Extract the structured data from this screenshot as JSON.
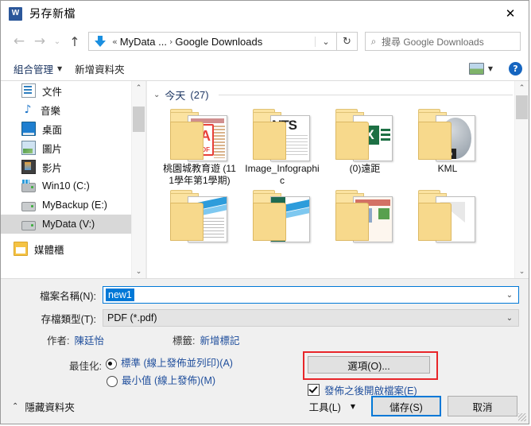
{
  "window": {
    "title": "另存新檔",
    "app_icon": "word-icon",
    "close_label": "✕"
  },
  "nav": {
    "back_icon": "←",
    "forward_icon": "→",
    "recent_icon": "⌄",
    "up_icon": "↑",
    "breadcrumb_icon": "download-arrow-icon",
    "crumb_prefix": "«",
    "crumb_root": "MyData ...",
    "crumb_sep": "›",
    "crumb_current": "Google Downloads",
    "crumb_dropdown_icon": "⌄",
    "refresh_icon": "↻",
    "search_icon": "⌕",
    "search_placeholder": "搜尋 Google Downloads"
  },
  "toolbar": {
    "organize_label": "組合管理",
    "organize_caret": "▼",
    "new_folder_label": "新增資料夾",
    "view_icon": "view-layout-icon",
    "view_caret": "▼",
    "help_label": "?"
  },
  "sidebar": {
    "items": [
      {
        "label": "文件",
        "icon": "document-icon",
        "selected": false
      },
      {
        "label": "音樂",
        "icon": "music-icon",
        "selected": false
      },
      {
        "label": "桌面",
        "icon": "desktop-icon",
        "selected": false
      },
      {
        "label": "圖片",
        "icon": "pictures-icon",
        "selected": false
      },
      {
        "label": "影片",
        "icon": "videos-icon",
        "selected": false
      },
      {
        "label": "Win10 (C:)",
        "icon": "drive-icon",
        "selected": false
      },
      {
        "label": "MyBackup (E:)",
        "icon": "drive-icon",
        "selected": false
      },
      {
        "label": "MyData (V:)",
        "icon": "drive-icon",
        "selected": true
      },
      {
        "label": "媒體櫃",
        "icon": "library-icon",
        "selected": false
      }
    ],
    "scroll_up_icon": "⌃",
    "scroll_down_icon": "⌄"
  },
  "files": {
    "group_chevron": "⌄",
    "group_title": "今天",
    "group_count": "(27)",
    "items": [
      {
        "name": "桃園城教育遊 (111學年第1學期)",
        "art": "pdf"
      },
      {
        "name": "Image_Infographic",
        "art": "font"
      },
      {
        "name": "(0)遠距",
        "art": "xls"
      },
      {
        "name": "KML",
        "art": "kml"
      }
    ],
    "row2": [
      {
        "art": "doc2"
      },
      {
        "art": "green"
      },
      {
        "art": "news"
      },
      {
        "art": "plain"
      }
    ],
    "scroll_up_icon": "⌃",
    "scroll_down_icon": "⌄"
  },
  "form": {
    "filename_label": "檔案名稱(N):",
    "filename_value": "new1",
    "filename_dropdown_icon": "⌄",
    "filetype_label": "存檔類型(T):",
    "filetype_value": "PDF (*.pdf)",
    "filetype_dropdown_icon": "⌄",
    "author_label": "作者:",
    "author_value": "陳廷怡",
    "tags_label": "標籤:",
    "tags_value": "新增標記",
    "optimize_label": "最佳化:",
    "optimize_options": [
      {
        "label": "標準 (線上發佈並列印)(A)",
        "selected": true
      },
      {
        "label": "最小值 (線上發佈)(M)",
        "selected": false
      }
    ],
    "options_button": "選項(O)...",
    "options_highlight_color": "#e8262a",
    "open_after_publish_label": "發佈之後開啟檔案(E)",
    "open_after_publish_checked": true
  },
  "footer": {
    "hide_folders_chevron": "⌃",
    "hide_folders_label": "隱藏資料夾",
    "tools_label": "工具(L)",
    "tools_caret": "▼",
    "save_label": "儲存(S)",
    "cancel_label": "取消"
  }
}
